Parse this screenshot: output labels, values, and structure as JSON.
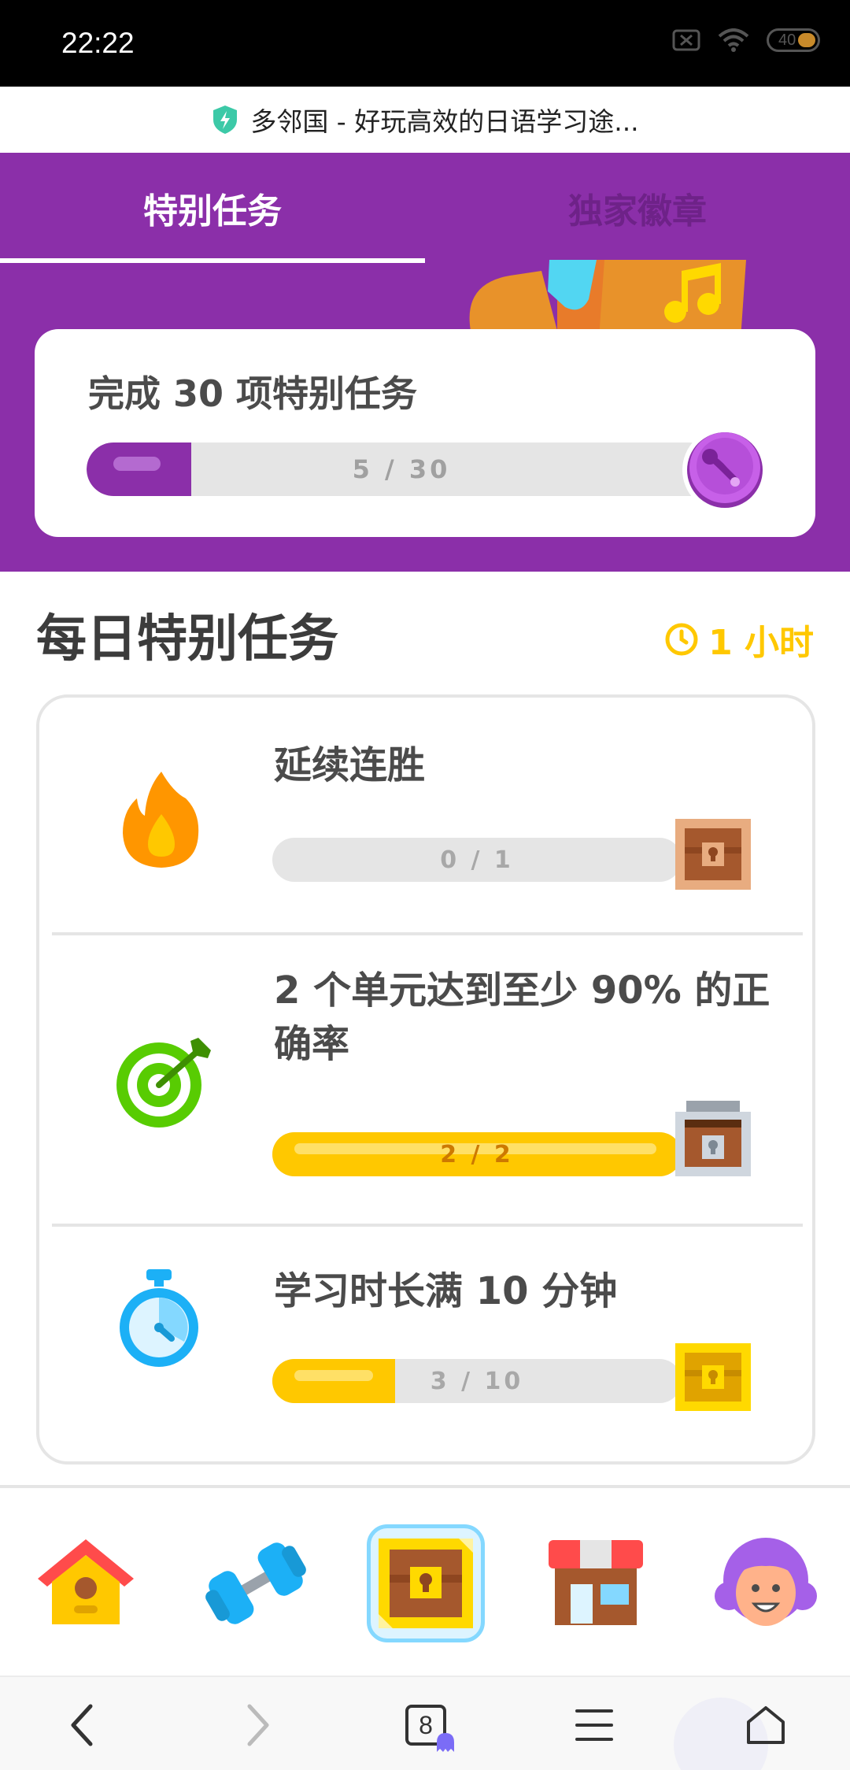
{
  "status_bar": {
    "time": "22:22",
    "battery": "40"
  },
  "browser": {
    "page_title": "多邻国 - 好玩高效的日语学习途..."
  },
  "tabs": [
    {
      "label": "特别任务",
      "active": true
    },
    {
      "label": "独家徽章",
      "active": false
    }
  ],
  "monthly": {
    "title": "完成 30 项特别任务",
    "progress_text": "5 / 30",
    "progress": 0.1667,
    "badge_icon": "trumpet-badge-icon"
  },
  "daily": {
    "title": "每日特别任务",
    "time_left": "1 小时"
  },
  "quests": [
    {
      "title": "延续连胜",
      "icon": "flame-icon",
      "progress_text": "0 / 1",
      "progress": 0,
      "chest": "chest-bronze-icon",
      "completed": false
    },
    {
      "title": "2 个单元达到至少 90% 的正确率",
      "icon": "target-icon",
      "progress_text": "2 / 2",
      "progress": 1,
      "chest": "chest-silver-open-icon",
      "completed": true
    },
    {
      "title": "学习时长满 10 分钟",
      "icon": "stopwatch-icon",
      "progress_text": "3 / 10",
      "progress": 0.3,
      "chest": "chest-gold-icon",
      "completed": false
    }
  ],
  "bottom_nav": [
    {
      "name": "home",
      "icon": "home-icon",
      "active": false
    },
    {
      "name": "practice",
      "icon": "dumbbell-icon",
      "active": false
    },
    {
      "name": "quests",
      "icon": "chest-nav-icon",
      "active": true
    },
    {
      "name": "shop",
      "icon": "shop-icon",
      "active": false
    },
    {
      "name": "profile",
      "icon": "avatar-icon",
      "active": false
    }
  ],
  "browser_bar": {
    "tab_count": "8"
  },
  "colors": {
    "purple": "#8b2fa9",
    "yellow": "#ffc800",
    "grey": "#e5e5e5"
  }
}
